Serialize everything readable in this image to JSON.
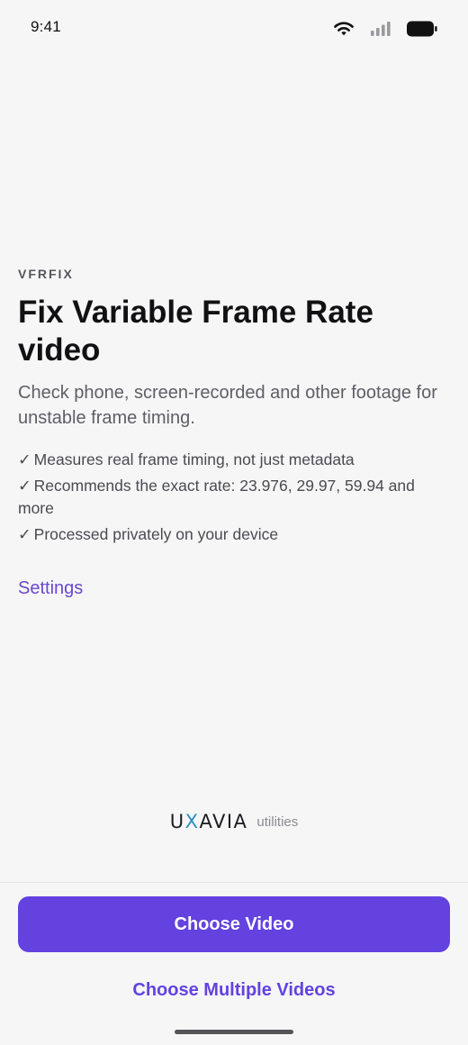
{
  "status_bar": {
    "time": "9:41",
    "icons": [
      "wifi-icon",
      "signal-icon",
      "battery-icon"
    ]
  },
  "hero": {
    "eyebrow": "VFRFIX",
    "title": "Fix Variable Frame Rate video",
    "subtitle": "Check phone, screen-recorded and other footage for unstable frame timing.",
    "check_glyph": "✓",
    "features": [
      "Measures real frame timing, not just metadata",
      "Recommends the exact rate: 23.976, 29.97, 59.94 and more",
      "Processed privately on your device"
    ],
    "settings_link": "Settings"
  },
  "brand": {
    "logo_pre": "U",
    "logo_x": "X",
    "logo_post": "AVIA",
    "suffix": "utilities"
  },
  "actions": {
    "primary": "Choose Video",
    "secondary": "Choose Multiple Videos"
  },
  "colors": {
    "accent": "#6342e0",
    "link": "#6a48cf",
    "background": "#f6f6f7",
    "brand_x": "#2a8fbd"
  }
}
